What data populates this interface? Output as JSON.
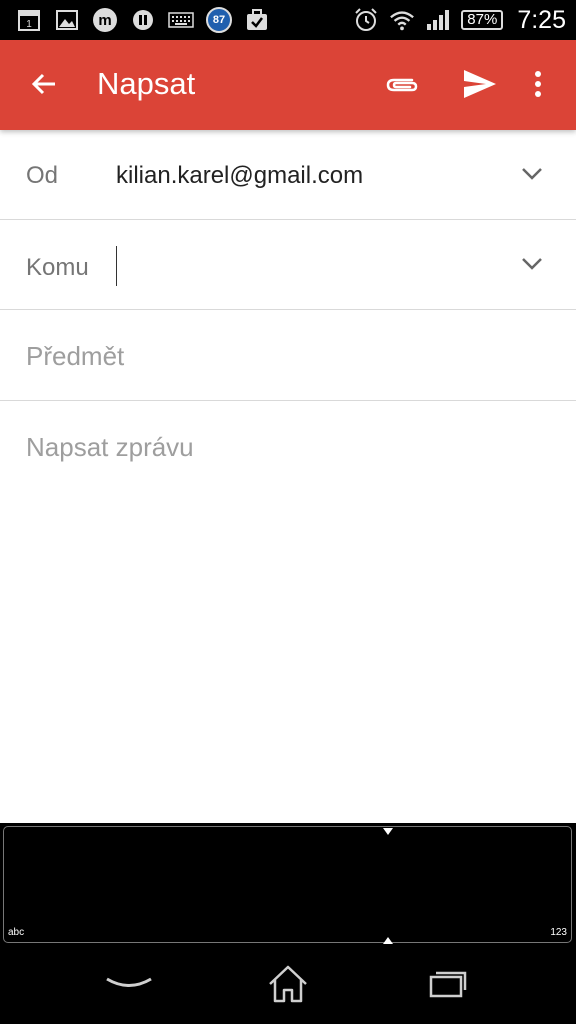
{
  "status_bar": {
    "notification_badge": "87",
    "battery_percent": "87%",
    "time": "7:25",
    "icons_left": [
      "calendar-icon",
      "gallery-icon",
      "m-app-icon",
      "pause-icon",
      "keyboard-icon",
      "badge-87-icon",
      "briefcase-check-icon"
    ],
    "icons_right": [
      "alarm-icon",
      "wifi-icon",
      "signal-icon",
      "battery-icon"
    ]
  },
  "app_bar": {
    "title": "Napsat",
    "color": "#db4437",
    "actions": [
      "back-arrow-icon",
      "attach-icon",
      "send-icon",
      "more-vert-icon"
    ]
  },
  "form": {
    "from_label": "Od",
    "from_value": "kilian.karel@gmail.com",
    "to_label": "Komu",
    "to_value": "",
    "subject_placeholder": "Předmět",
    "body_placeholder": "Napsat zprávu"
  },
  "keyboard": {
    "left_corner": "abc",
    "right_corner": "123"
  },
  "nav_bar": {
    "buttons": [
      "back-icon",
      "home-icon",
      "recents-icon"
    ]
  }
}
